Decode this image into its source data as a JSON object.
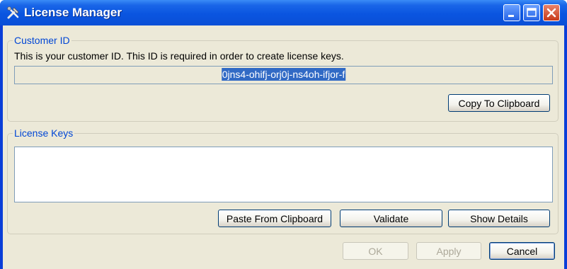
{
  "window": {
    "title": "License Manager"
  },
  "customer": {
    "legend": "Customer ID",
    "description": "This is your customer ID. This ID is required in order to create license keys.",
    "id_value": "0jns4-ohifj-orj0j-ns4oh-ifjor-f",
    "copy_button": "Copy To Clipboard"
  },
  "license": {
    "legend": "License Keys",
    "keys_value": "",
    "paste_button": "Paste From Clipboard",
    "validate_button": "Validate",
    "details_button": "Show Details"
  },
  "footer": {
    "ok": "OK",
    "apply": "Apply",
    "cancel": "Cancel"
  }
}
